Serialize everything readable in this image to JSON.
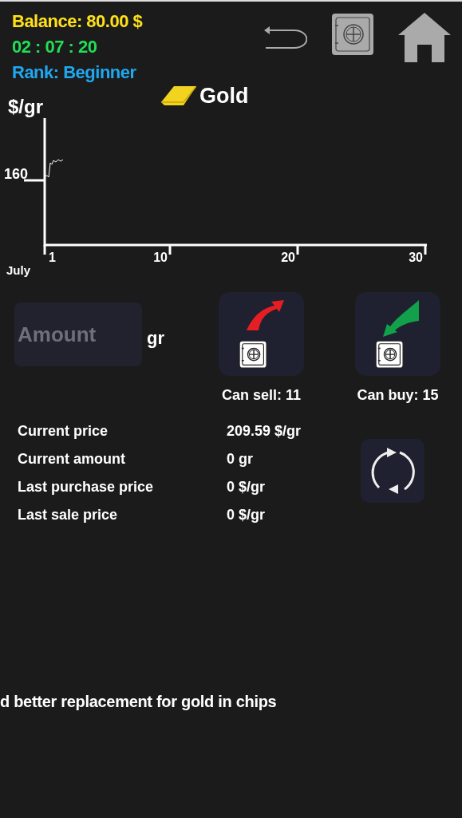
{
  "header": {
    "balance": "Balance: 80.00 $",
    "timer": "02 : 07 : 20",
    "rank": "Rank: Beginner"
  },
  "chart": {
    "title": "Gold",
    "y_unit": "$/gr",
    "y_tick": "160",
    "x_ticks": [
      "1",
      "10",
      "20",
      "30"
    ],
    "month": "July"
  },
  "trade": {
    "amount_placeholder": "Amount",
    "unit": "gr",
    "can_sell": "Can sell: 11",
    "can_buy": "Can buy: 15"
  },
  "info": [
    {
      "label": "Current price",
      "value": "209.59 $/gr"
    },
    {
      "label": "Current amount",
      "value": "0 gr"
    },
    {
      "label": "Last purchase price",
      "value": "0 $/gr"
    },
    {
      "label": "Last sale price",
      "value": "0 $/gr"
    }
  ],
  "ticker": "d better replacement for gold in chips"
}
